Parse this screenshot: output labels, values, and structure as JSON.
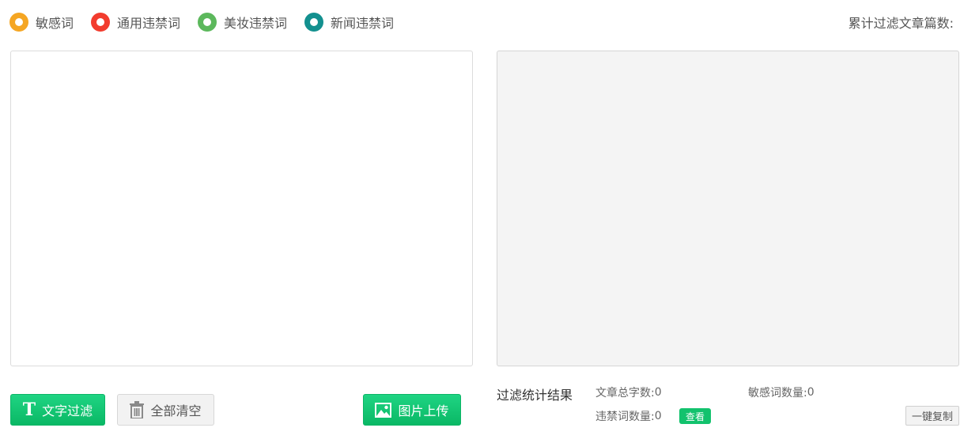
{
  "legend": [
    {
      "label": "敏感词",
      "color": "#f5a623"
    },
    {
      "label": "通用违禁词",
      "color": "#f23c2e"
    },
    {
      "label": "美妆违禁词",
      "color": "#5cb85c"
    },
    {
      "label": "新闻违禁词",
      "color": "#13908f"
    }
  ],
  "header": {
    "total_filtered_label": "累计过滤文章篇数:"
  },
  "input": {
    "value": "",
    "placeholder": ""
  },
  "buttons": {
    "filter_label": "文字过滤",
    "clear_label": "全部清空",
    "upload_label": "图片上传"
  },
  "stats": {
    "title": "过滤统计结果",
    "total_chars_label": "文章总字数:",
    "total_chars_value": "0",
    "sensitive_label": "敏感词数量:",
    "sensitive_value": "0",
    "banned_label": "违禁词数量:",
    "banned_value": "0",
    "view_label": "查看",
    "copy_label": "一键复制"
  },
  "colors": {
    "accent_green": "#12c26d"
  }
}
